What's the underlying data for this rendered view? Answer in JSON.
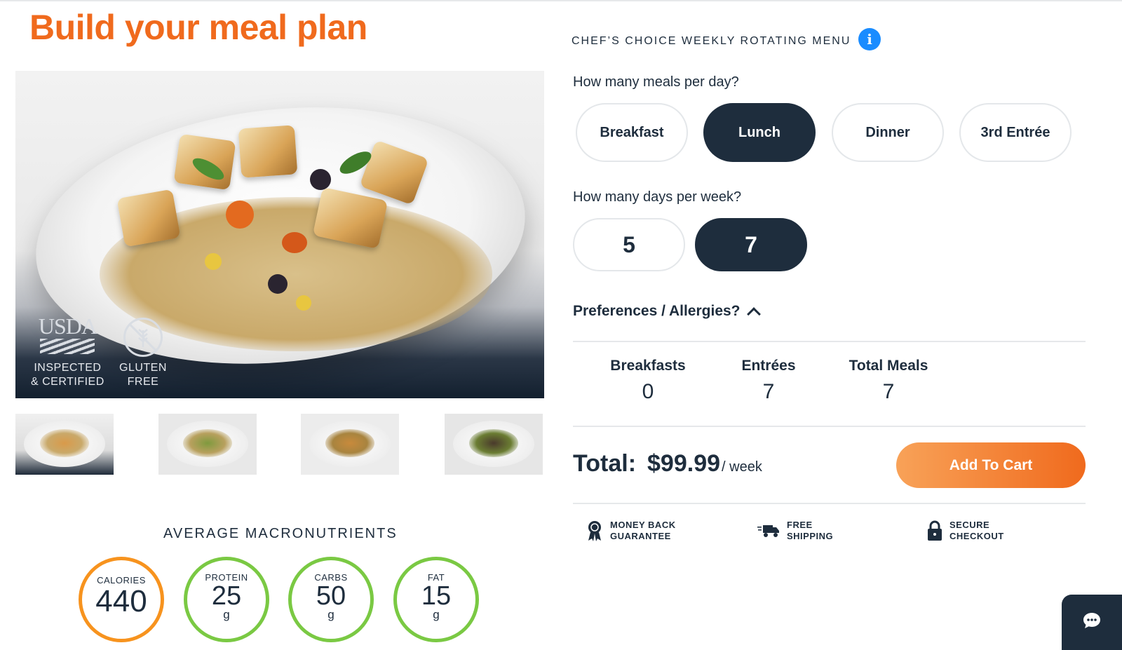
{
  "page": {
    "title": "Build your meal plan"
  },
  "hero": {
    "usda_mark": "USDA",
    "usda_text_line1": "INSPECTED",
    "usda_text_line2": "& CERTIFIED",
    "gf_text_line1": "GLUTEN",
    "gf_text_line2": "FREE"
  },
  "macros": {
    "title": "AVERAGE MACRONUTRIENTS",
    "items": [
      {
        "label": "CALORIES",
        "value": "440",
        "unit": ""
      },
      {
        "label": "PROTEIN",
        "value": "25",
        "unit": "g"
      },
      {
        "label": "CARBS",
        "value": "50",
        "unit": "g"
      },
      {
        "label": "FAT",
        "value": "15",
        "unit": "g"
      }
    ]
  },
  "menu": {
    "label": "CHEF’S CHOICE WEEKLY ROTATING MENU",
    "info_icon": "info-icon"
  },
  "meals_per_day": {
    "question": "How many meals per day?",
    "options": [
      "Breakfast",
      "Lunch",
      "Dinner",
      "3rd Entrée"
    ],
    "selected": "Lunch"
  },
  "days_per_week": {
    "question": "How many days per week?",
    "options": [
      "5",
      "7"
    ],
    "selected": "7"
  },
  "preferences": {
    "label": "Preferences / Allergies?"
  },
  "summary": {
    "items": [
      {
        "label": "Breakfasts",
        "value": "0"
      },
      {
        "label": "Entrées",
        "value": "7"
      },
      {
        "label": "Total Meals",
        "value": "7"
      }
    ]
  },
  "total": {
    "label": "Total:",
    "price": "$99.99",
    "unit": "/ week",
    "cart_button": "Add To Cart"
  },
  "trust": [
    {
      "icon": "medal-icon",
      "line1": "MONEY BACK",
      "line2": "GUARANTEE"
    },
    {
      "icon": "truck-icon",
      "line1": "FREE",
      "line2": "SHIPPING"
    },
    {
      "icon": "lock-icon",
      "line1": "SECURE",
      "line2": "CHECKOUT"
    }
  ],
  "colors": {
    "accent": "#f06a1d",
    "dark": "#1e2d3d",
    "info": "#1a8cff",
    "macro_green": "#7ac943",
    "macro_orange": "#f7931e"
  }
}
